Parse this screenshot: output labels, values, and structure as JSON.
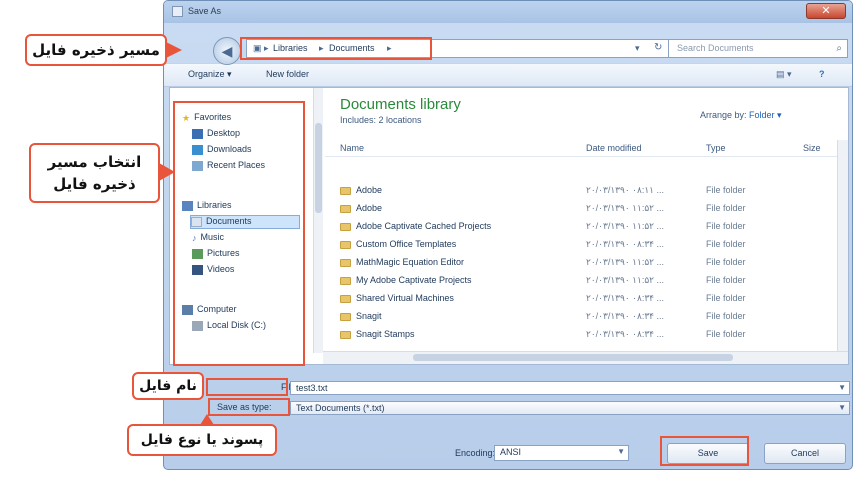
{
  "window": {
    "title": "Save As",
    "close_glyph": "✕"
  },
  "address_bar": {
    "crumbs": [
      "Libraries",
      "Documents"
    ],
    "search_placeholder": "Search Documents"
  },
  "toolbar": {
    "organize_label": "Organize ▾",
    "new_folder_label": "New folder"
  },
  "nav": {
    "items": [
      {
        "label": "Favorites",
        "icon": "star-icon",
        "color": "#e6b422"
      },
      {
        "label": "Desktop",
        "icon": "desktop-icon",
        "color": "#3a6fb4"
      },
      {
        "label": "Downloads",
        "icon": "downloads-icon",
        "color": "#3a8fd0"
      },
      {
        "label": "Recent Places",
        "icon": "recent-places-icon",
        "color": "#7fa8d0"
      },
      {
        "label": "Libraries",
        "icon": "libraries-icon",
        "color": "#5a84bd"
      },
      {
        "label": "Documents",
        "icon": "documents-icon",
        "color": "#d9e4f0"
      },
      {
        "label": "Music",
        "icon": "music-icon",
        "color": "#3a7ec8"
      },
      {
        "label": "Pictures",
        "icon": "pictures-icon",
        "color": "#5a9a5a"
      },
      {
        "label": "Videos",
        "icon": "videos-icon",
        "color": "#35547f"
      },
      {
        "label": "Computer",
        "icon": "computer-icon",
        "color": "#5a7ea8"
      },
      {
        "label": "Local Disk (C:)",
        "icon": "disk-icon",
        "color": "#9aa7b6"
      }
    ]
  },
  "library": {
    "title": "Documents library",
    "subtitle": "Includes: 2 locations",
    "arrange_label": "Arrange by:",
    "arrange_value": "Folder ▾"
  },
  "columns": [
    "Name",
    "Date modified",
    "Type",
    "Size"
  ],
  "files": [
    {
      "name": "Adobe",
      "date": "۲۰/۰۳/۱۳۹۰ ۰۸:۱۱ ...",
      "type": "File folder"
    },
    {
      "name": "Adobe",
      "date": "۲۰/۰۳/۱۳۹۰ ۱۱:۵۲ ...",
      "type": "File folder"
    },
    {
      "name": "Adobe Captivate Cached Projects",
      "date": "۲۰/۰۳/۱۳۹۰ ۱۱:۵۲ ...",
      "type": "File folder"
    },
    {
      "name": "Custom Office Templates",
      "date": "۲۰/۰۳/۱۳۹۰ ۰۸:۳۴ ...",
      "type": "File folder"
    },
    {
      "name": "MathMagic Equation Editor",
      "date": "۲۰/۰۳/۱۳۹۰ ۱۱:۵۲ ...",
      "type": "File folder"
    },
    {
      "name": "My Adobe Captivate Projects",
      "date": "۲۰/۰۳/۱۳۹۰ ۱۱:۵۲ ...",
      "type": "File folder"
    },
    {
      "name": "Shared Virtual Machines",
      "date": "۲۰/۰۳/۱۳۹۰ ۰۸:۳۴ ...",
      "type": "File folder"
    },
    {
      "name": "Snagit",
      "date": "۲۰/۰۳/۱۳۹۰ ۰۸:۳۴ ...",
      "type": "File folder"
    },
    {
      "name": "Snagit Stamps",
      "date": "۲۰/۰۳/۱۳۹۰ ۰۸:۳۴ ...",
      "type": "File folder"
    }
  ],
  "form": {
    "file_name_label": "File name:",
    "file_name_value": "test3.txt",
    "save_type_label": "Save as type:",
    "save_type_value": "Text Documents (*.txt)",
    "encoding_label": "Encoding:",
    "encoding_value": "ANSI",
    "save_label": "Save",
    "cancel_label": "Cancel"
  },
  "annotations": {
    "path_callout": "مسیر ذخیره فایل",
    "select_callout_line1": "انتخاب مسیر",
    "select_callout_line2": "ذخیره فایل",
    "name_callout": "نام فایل",
    "type_callout": "پسوند یا نوع فایل",
    "highlight_color": "#e8553a"
  }
}
